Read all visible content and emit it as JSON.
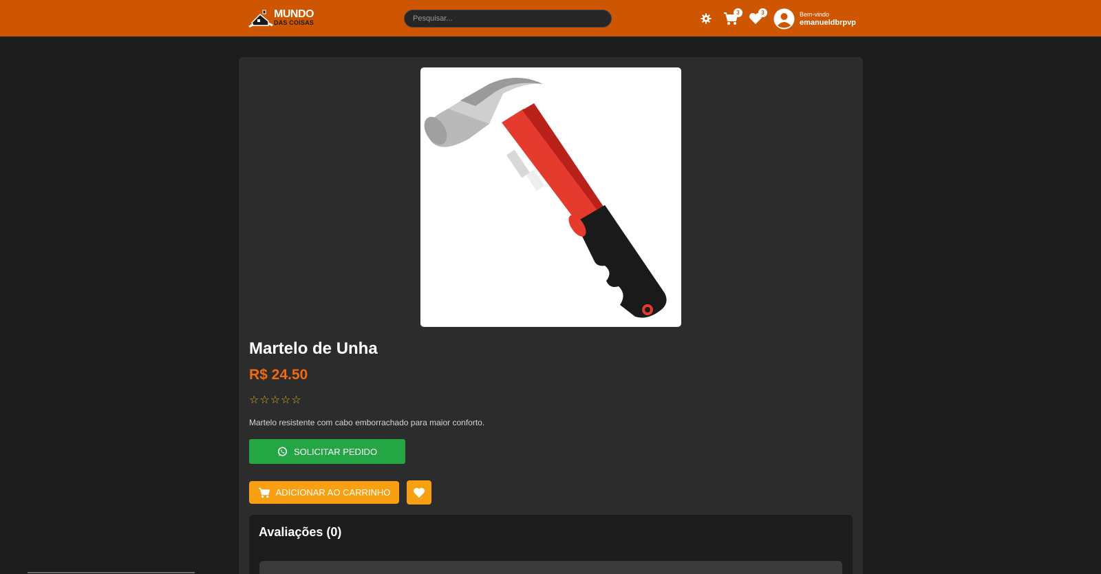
{
  "header": {
    "logo": {
      "line1": "MUNDO",
      "line2": "DAS COISAS"
    },
    "search": {
      "placeholder": "Pesquisar..."
    },
    "settings_icon": "gear-icon",
    "cart": {
      "icon": "cart-icon",
      "count": "3"
    },
    "favorites": {
      "icon": "heart-icon",
      "count": "3"
    },
    "user": {
      "greeting": "Bem-vindo",
      "name": "emanueldbrpvp"
    }
  },
  "product": {
    "title": "Martelo de Unha",
    "price": "R$ 24.50",
    "rating": 0,
    "stars": [
      "☆",
      "☆",
      "☆",
      "☆",
      "☆"
    ],
    "description": "Martelo resistente com cabo emborrachado para maior conforto.",
    "image_icon": "hammer-image"
  },
  "actions": {
    "whatsapp_label": "SOLICITAR PEDIDO",
    "cart_label": "ADICIONAR AO CARRINHO"
  },
  "reviews": {
    "title": "Avaliações (0)"
  },
  "colors": {
    "header": "#cf5600",
    "accent": "#f8a012",
    "price": "#f06a12",
    "whatsapp": "#24a645"
  }
}
